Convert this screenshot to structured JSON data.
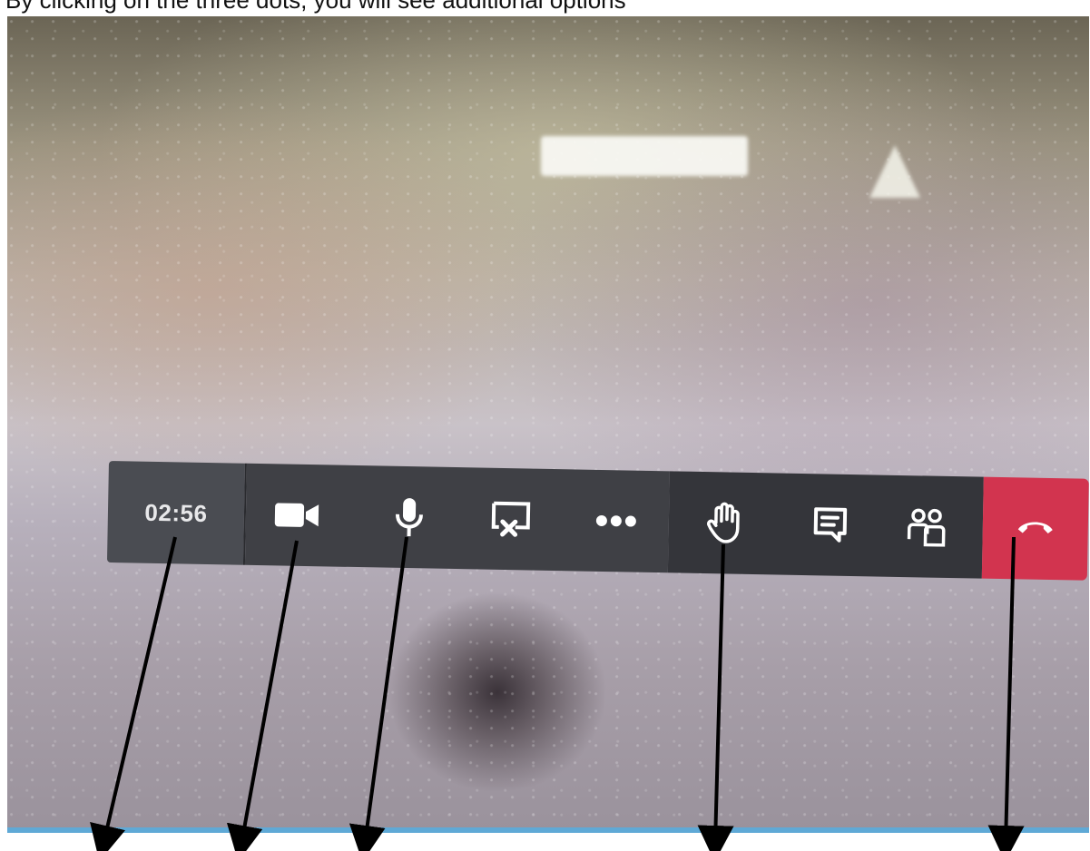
{
  "caption": {
    "text": "By clicking on the three dots, you will see additional options"
  },
  "call_toolbar": {
    "timer": "02:56",
    "buttons": {
      "camera": {
        "icon": "video-camera-icon"
      },
      "microphone": {
        "icon": "microphone-icon"
      },
      "share": {
        "icon": "stop-share-screen-icon"
      },
      "more": {
        "icon": "more-options-icon"
      },
      "raise_hand": {
        "icon": "raise-hand-icon"
      },
      "chat": {
        "icon": "chat-icon"
      },
      "participants": {
        "icon": "participants-icon"
      },
      "hang_up": {
        "icon": "hang-up-icon"
      }
    },
    "colors": {
      "hang_up_bg": "#d2344f",
      "toolbar_bg": "#3f4045",
      "icon": "#ffffff"
    }
  }
}
